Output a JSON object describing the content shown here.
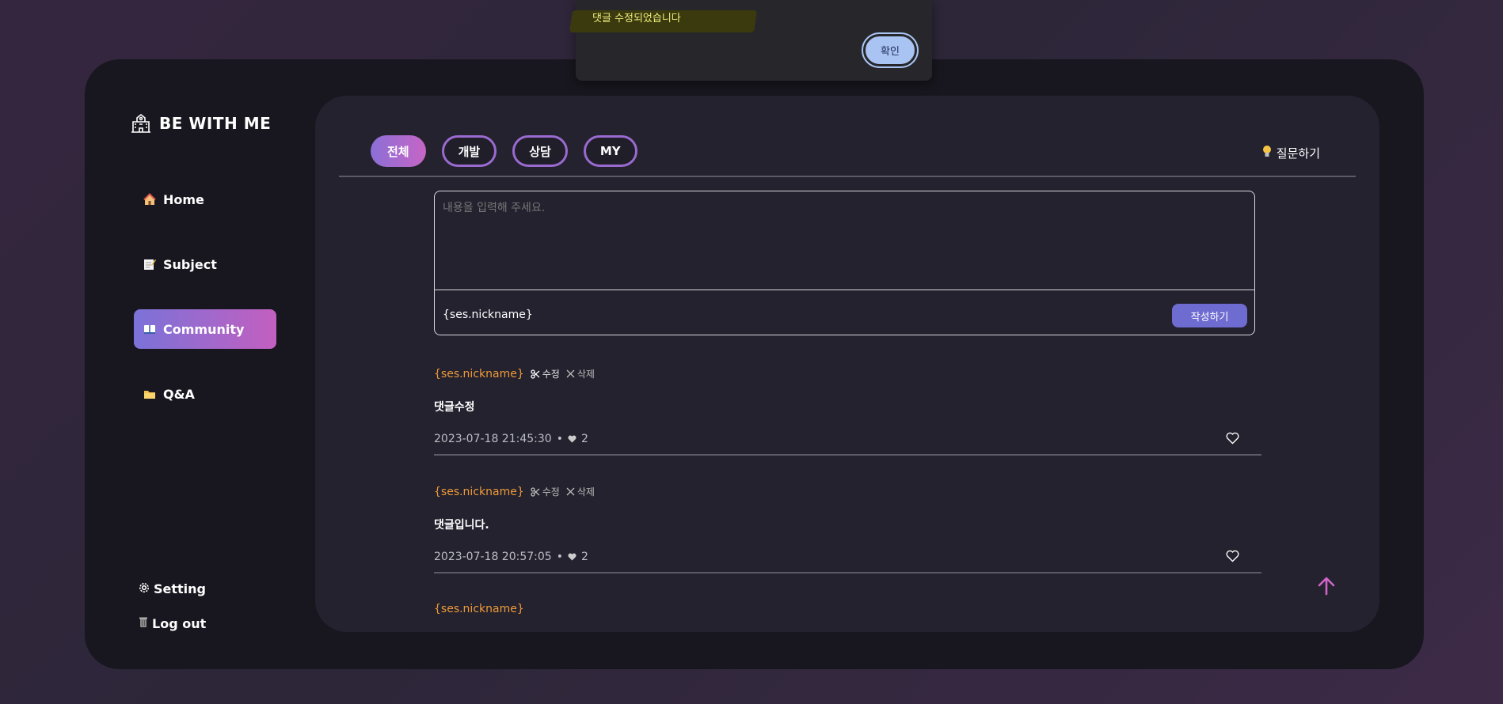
{
  "brand": {
    "name": "BE WITH ME",
    "icon": "school-building-icon"
  },
  "sidebar": {
    "items": [
      {
        "label": "Home",
        "icon": "house-icon",
        "active": false
      },
      {
        "label": "Subject",
        "icon": "memo-icon",
        "active": false
      },
      {
        "label": "Community",
        "icon": "open-book-icon",
        "active": true
      },
      {
        "label": "Q&A",
        "icon": "folder-icon",
        "active": false
      }
    ],
    "setting_label": "Setting",
    "logout_label": "Log out"
  },
  "tabs": [
    {
      "label": "전체",
      "active": true
    },
    {
      "label": "개발",
      "active": false
    },
    {
      "label": "상담",
      "active": false
    },
    {
      "label": "MY",
      "active": false
    }
  ],
  "ask_button": {
    "label": "질문하기",
    "icon": "lightbulb-icon"
  },
  "composer": {
    "placeholder": "내용을 입력해 주세요.",
    "nickname": "{ses.nickname}",
    "submit_label": "작성하기"
  },
  "comments": [
    {
      "nickname": "{ses.nickname}",
      "edit_label": "수정",
      "delete_label": "삭제",
      "body": "댓글수정",
      "timestamp": "2023-07-18 21:45:30",
      "likes": "2"
    },
    {
      "nickname": "{ses.nickname}",
      "edit_label": "수정",
      "delete_label": "삭제",
      "body": "댓글입니다.",
      "timestamp": "2023-07-18 20:57:05",
      "likes": "2"
    },
    {
      "nickname": "{ses.nickname}"
    }
  ],
  "dialog": {
    "message": "댓글 수정되었습니다",
    "confirm_label": "확인"
  },
  "colors": {
    "accent_gradient_start": "#7b72d8",
    "accent_gradient_end": "#c35fc0",
    "nickname": "#ef9a3a",
    "submit": "#6e6cd1",
    "dialog_button": "#a9c3f2"
  }
}
